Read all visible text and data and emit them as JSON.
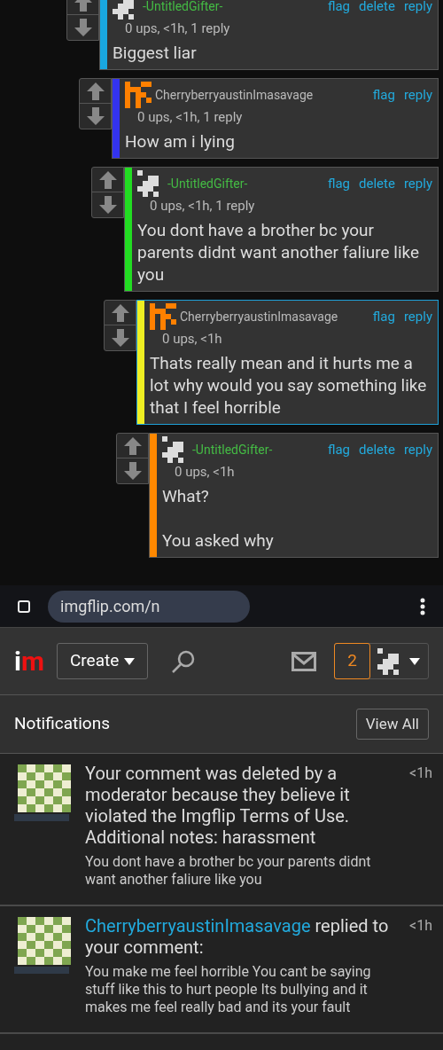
{
  "comments": {
    "author": {
      "name": "-UntitledGifter-",
      "color": "#44bb44",
      "kind": "gray"
    },
    "actions": [
      "flag",
      "delete",
      "reply"
    ],
    "meta": "0 ups, <1h, 1 reply",
    "body": "Biggest liar",
    "color": "#19a7e0",
    "highlighted": false,
    "children": [
      {
        "author": {
          "name": "CherryberryaustinImasavage",
          "color": "#bbbbbb",
          "kind": "orange"
        },
        "actions": [
          "flag",
          "reply"
        ],
        "meta": "0 ups, <1h, 1 reply",
        "body": "How am i lying",
        "color": "#3333ee",
        "highlighted": false,
        "children": [
          {
            "author": {
              "name": "-UntitledGifter-",
              "color": "#44bb44",
              "kind": "gray"
            },
            "actions": [
              "flag",
              "delete",
              "reply"
            ],
            "meta": "0 ups, <1h, 1 reply",
            "body": "You dont have a brother bc your parents didnt want another faliure like you",
            "color": "#22dd22",
            "highlighted": false,
            "children": [
              {
                "author": {
                  "name": "CherryberryaustinImasavage",
                  "color": "#bbbbbb",
                  "kind": "orange"
                },
                "actions": [
                  "flag",
                  "reply"
                ],
                "meta": "0 ups, <1h",
                "body": "Thats really mean and it hurts me a lot why would you say something like that I feel horrible",
                "color": "#eeee22",
                "highlighted": true,
                "children": [
                  {
                    "author": {
                      "name": "-UntitledGifter-",
                      "color": "#44bb44",
                      "kind": "gray"
                    },
                    "actions": [
                      "flag",
                      "delete",
                      "reply"
                    ],
                    "meta": "0 ups, <1h",
                    "body": "What?\n\nYou asked why",
                    "color": "#ff8800",
                    "highlighted": false
                  }
                ]
              }
            ]
          }
        ]
      }
    ]
  },
  "browser": {
    "url": "imgflip.com/n"
  },
  "header": {
    "logo": [
      "i",
      "m"
    ],
    "create": "Create",
    "notification_count": "2"
  },
  "notifications": {
    "title": "Notifications",
    "view_all": "View All",
    "items": [
      {
        "kind": "deleted",
        "text": "Your comment was deleted by a moderator because they believe it violated the Imgflip Terms of Use. Additional notes: harassment",
        "time": "<1h",
        "excerpt": "You dont have a brother bc your parents didnt want another faliure like you"
      },
      {
        "kind": "reply",
        "actor": "CherryberryaustinImasavage",
        "text": "replied to your comment:",
        "time": "<1h",
        "excerpt": "You make me feel horrible You cant be saying stuff like this to hurt people Its bullying and it makes me feel really bad and its your fault"
      }
    ]
  }
}
